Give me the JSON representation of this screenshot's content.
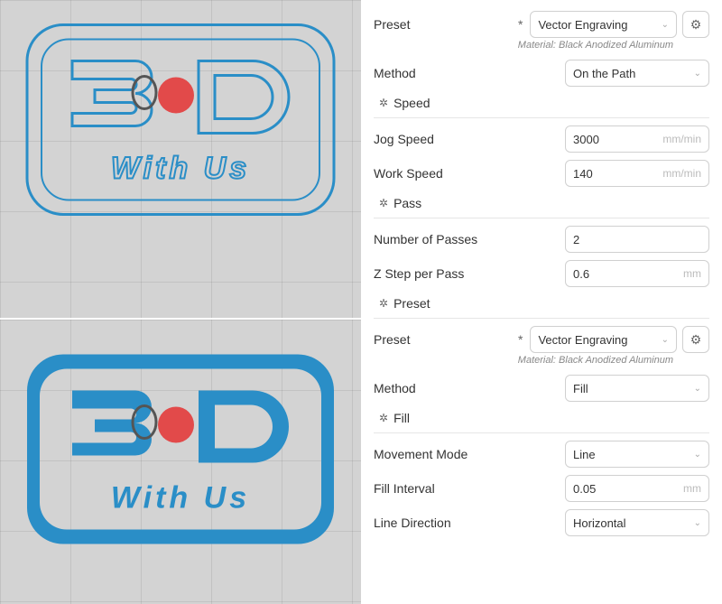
{
  "canvas": {
    "logo_text": "With Us",
    "outline_color": "#2a8ec7",
    "fill_color": "#2a8ec7",
    "dot_color": "#e24a4a"
  },
  "panel": {
    "preset_label": "Preset",
    "preset1_value": "Vector Engraving",
    "material1": "Material: Black Anodized Aluminum",
    "method_label": "Method",
    "method1_value": "On the Path",
    "speed_header": "Speed",
    "jog_label": "Jog Speed",
    "jog_value": "3000",
    "jog_unit": "mm/min",
    "work_label": "Work Speed",
    "work_value": "140",
    "work_unit": "mm/min",
    "pass_header": "Pass",
    "passes_label": "Number of Passes",
    "passes_value": "2",
    "zstep_label": "Z Step per Pass",
    "zstep_value": "0.6",
    "zstep_unit": "mm",
    "preset_header": "Preset",
    "preset2_value": "Vector Engraving",
    "material2": "Material: Black Anodized Aluminum",
    "method2_value": "Fill",
    "fill_header": "Fill",
    "movemode_label": "Movement Mode",
    "movemode_value": "Line",
    "fillint_label": "Fill Interval",
    "fillint_value": "0.05",
    "fillint_unit": "mm",
    "linedir_label": "Line Direction",
    "linedir_value": "Horizontal"
  }
}
